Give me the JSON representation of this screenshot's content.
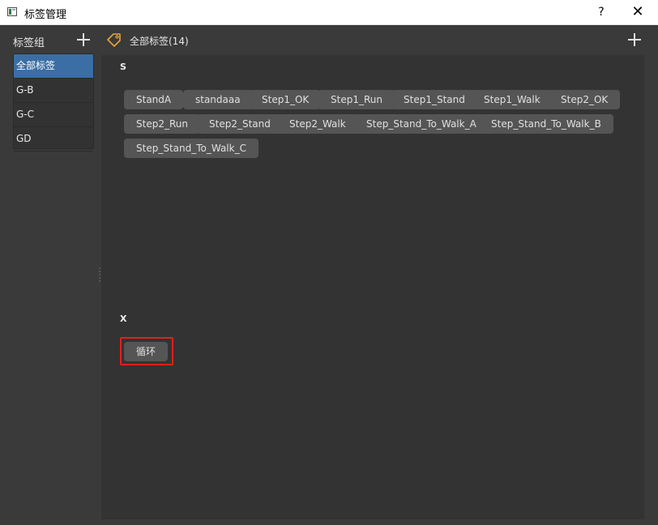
{
  "window": {
    "title": "标签管理",
    "help_label": "?",
    "close_label": "✕"
  },
  "left_panel": {
    "header": "标签组",
    "add_icon": "plus-icon",
    "groups": [
      {
        "label": "全部标签",
        "selected": true
      },
      {
        "label": "G-B",
        "selected": false
      },
      {
        "label": "G-C",
        "selected": false
      },
      {
        "label": "GD",
        "selected": false
      }
    ]
  },
  "right_panel": {
    "header": "全部标签(14)",
    "header_icon": "tag-icon",
    "add_icon": "plus-icon",
    "sections": [
      {
        "label": "S",
        "tags": [
          "StandA",
          "standaaa",
          "Step1_OK",
          "Step1_Run",
          "Step1_Stand",
          "Step1_Walk",
          "Step2_OK",
          "Step2_Run",
          "Step2_Stand",
          "Step2_Walk",
          "Step_Stand_To_Walk_A",
          "Step_Stand_To_Walk_B",
          "Step_Stand_To_Walk_C"
        ]
      },
      {
        "label": "X",
        "tags": [
          "循环"
        ]
      }
    ]
  },
  "colors": {
    "selected_item": "#3a6ea5",
    "chip_bg": "#555555",
    "highlight": "#e51e1e",
    "tag_icon": "#e8a23a"
  }
}
